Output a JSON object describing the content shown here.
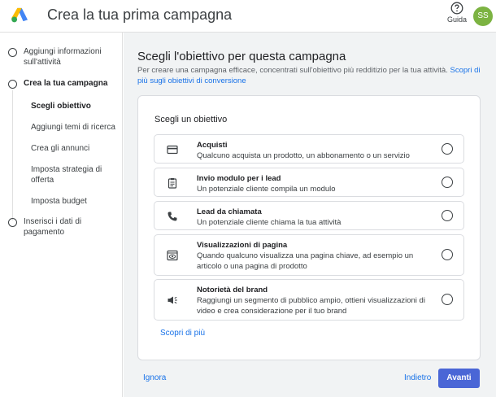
{
  "header": {
    "title": "Crea la tua prima campagna",
    "help_label": "Guida",
    "avatar_initials": "SS"
  },
  "sidebar": {
    "steps": [
      {
        "label": "Aggiungi informazioni sull'attività"
      },
      {
        "label": "Crea la tua campagna"
      },
      {
        "label": "Inserisci i dati di pagamento"
      }
    ],
    "substeps": [
      {
        "label": "Scegli obiettivo"
      },
      {
        "label": "Aggiungi temi di ricerca"
      },
      {
        "label": "Crea gli annunci"
      },
      {
        "label": "Imposta strategia di offerta"
      },
      {
        "label": "Imposta budget"
      }
    ]
  },
  "main": {
    "title": "Scegli l'obiettivo per questa campagna",
    "description": "Per creare una campagna efficace, concentrati sull'obiettivo più redditizio per la tua attività.",
    "description_link": "Scopri di più sugli obiettivi di conversione",
    "card_title": "Scegli un obiettivo",
    "options": [
      {
        "name": "Acquisti",
        "desc": "Qualcuno acquista un prodotto, un abbonamento o un servizio",
        "icon": "credit-card-icon"
      },
      {
        "name": "Invio modulo per i lead",
        "desc": "Un potenziale cliente compila un modulo",
        "icon": "form-icon"
      },
      {
        "name": "Lead da chiamata",
        "desc": "Un potenziale cliente chiama la tua attività",
        "icon": "phone-icon"
      },
      {
        "name": "Visualizzazioni di pagina",
        "desc": "Quando qualcuno visualizza una pagina chiave, ad esempio un articolo o una pagina di prodotto",
        "icon": "page-view-icon"
      },
      {
        "name": "Notorietà del brand",
        "desc": "Raggiungi un segmento di pubblico ampio, ottieni visualizzazioni di video e crea considerazione per il tuo brand",
        "icon": "megaphone-icon"
      }
    ],
    "more_link": "Scopri di più"
  },
  "footer": {
    "skip": "Ignora",
    "back": "Indietro",
    "next": "Avanti"
  },
  "colors": {
    "accent": "#1a73e8",
    "primary_button": "#4a66d6",
    "avatar": "#7cb342"
  }
}
